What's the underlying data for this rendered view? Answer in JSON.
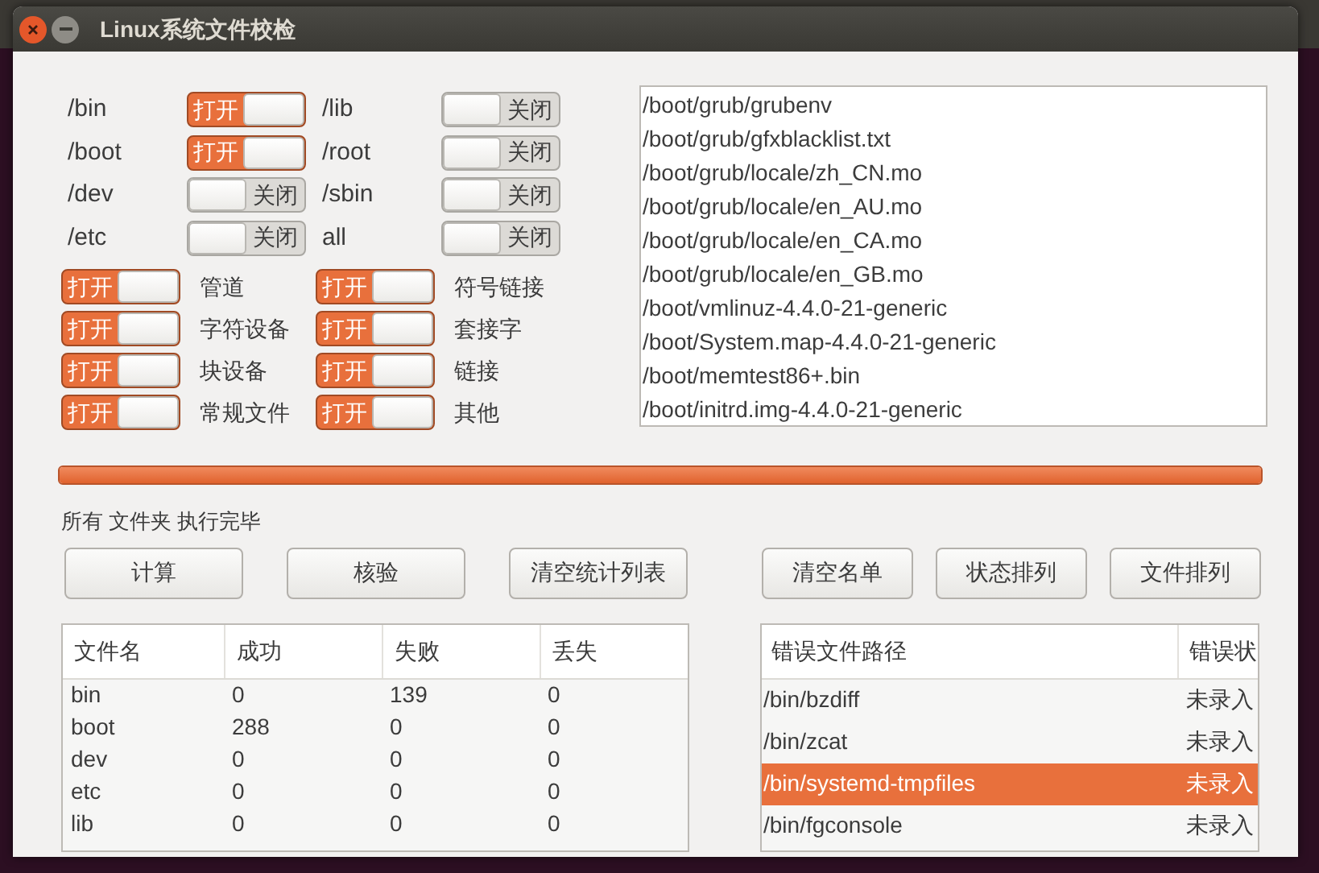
{
  "window": {
    "title": "Linux系统文件校检"
  },
  "folder_switches": [
    {
      "label": "/bin",
      "on": true,
      "text": "打开"
    },
    {
      "label": "/lib",
      "on": false,
      "text": "关闭"
    },
    {
      "label": "/boot",
      "on": true,
      "text": "打开"
    },
    {
      "label": "/root",
      "on": false,
      "text": "关闭"
    },
    {
      "label": "/dev",
      "on": false,
      "text": "关闭"
    },
    {
      "label": "/sbin",
      "on": false,
      "text": "关闭"
    },
    {
      "label": "/etc",
      "on": false,
      "text": "关闭"
    },
    {
      "label": "all",
      "on": false,
      "text": "关闭"
    }
  ],
  "type_switches": [
    {
      "label": "管道",
      "on": true,
      "text": "打开"
    },
    {
      "label": "符号链接",
      "on": true,
      "text": "打开"
    },
    {
      "label": "字符设备",
      "on": true,
      "text": "打开"
    },
    {
      "label": "套接字",
      "on": true,
      "text": "打开"
    },
    {
      "label": "块设备",
      "on": true,
      "text": "打开"
    },
    {
      "label": "链接",
      "on": true,
      "text": "打开"
    },
    {
      "label": "常规文件",
      "on": true,
      "text": "打开"
    },
    {
      "label": "其他",
      "on": true,
      "text": "打开"
    }
  ],
  "file_list": [
    "/boot/grub/grubenv",
    "/boot/grub/gfxblacklist.txt",
    "/boot/grub/locale/zh_CN.mo",
    "/boot/grub/locale/en_AU.mo",
    "/boot/grub/locale/en_CA.mo",
    "/boot/grub/locale/en_GB.mo",
    "/boot/vmlinuz-4.4.0-21-generic",
    "/boot/System.map-4.4.0-21-generic",
    "/boot/memtest86+.bin",
    "/boot/initrd.img-4.4.0-21-generic"
  ],
  "progress": {
    "level": 1
  },
  "status": "所有 文件夹 执行完毕",
  "left_buttons": [
    "计算",
    "核验",
    "清空统计列表"
  ],
  "right_buttons": [
    "清空名单",
    "状态排列",
    "文件排列"
  ],
  "stats_table": {
    "columns": [
      "文件名",
      "成功",
      "失败",
      "丢失"
    ],
    "rows": [
      [
        "bin",
        "0",
        "139",
        "0"
      ],
      [
        "boot",
        "288",
        "0",
        "0"
      ],
      [
        "dev",
        "0",
        "0",
        "0"
      ],
      [
        "etc",
        "0",
        "0",
        "0"
      ],
      [
        "lib",
        "0",
        "0",
        "0"
      ]
    ]
  },
  "error_table": {
    "columns": [
      "错误文件路径",
      "错误状"
    ],
    "rows": [
      {
        "path": "/bin/bzdiff",
        "state": "未录入",
        "selected": false
      },
      {
        "path": "/bin/zcat",
        "state": "未录入",
        "selected": false
      },
      {
        "path": "/bin/systemd-tmpfiles",
        "state": "未录入",
        "selected": true
      },
      {
        "path": "/bin/fgconsole",
        "state": "未录入",
        "selected": false
      }
    ]
  }
}
